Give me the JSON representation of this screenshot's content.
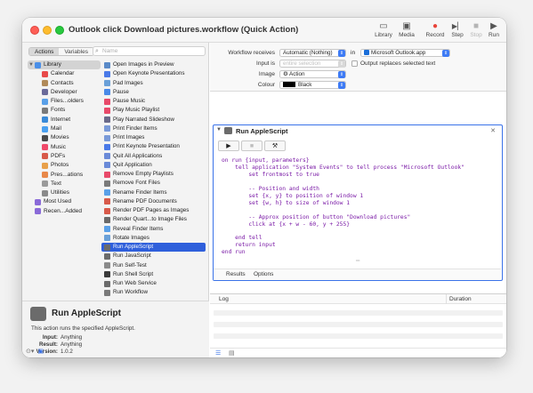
{
  "window": {
    "title": "Outlook click Download pictures.workflow (Quick Action)"
  },
  "toolbar": [
    {
      "label": "Library",
      "icon": "library-icon",
      "glyph": "▭",
      "enabled": true
    },
    {
      "label": "Media",
      "icon": "media-icon",
      "glyph": "▣",
      "enabled": true
    },
    {
      "label": "Record",
      "icon": "record-icon",
      "glyph": "●",
      "enabled": true
    },
    {
      "label": "Step",
      "icon": "step-icon",
      "glyph": "▶▏",
      "enabled": true
    },
    {
      "label": "Stop",
      "icon": "stop-icon",
      "glyph": "■",
      "enabled": false
    },
    {
      "label": "Run",
      "icon": "run-icon",
      "glyph": "▶",
      "enabled": true
    }
  ],
  "tabs": {
    "actions": "Actions",
    "variables": "Variables"
  },
  "search": {
    "placeholder": "Name"
  },
  "library": [
    {
      "label": "Library",
      "color": "#4a8fe8",
      "level": 0,
      "selected": true
    },
    {
      "label": "Calendar",
      "color": "#e84a4a",
      "level": 1
    },
    {
      "label": "Contacts",
      "color": "#b08a5a",
      "level": 1
    },
    {
      "label": "Developer",
      "color": "#6a6a9a",
      "level": 1
    },
    {
      "label": "Files...olders",
      "color": "#5aa0e8",
      "level": 1
    },
    {
      "label": "Fonts",
      "color": "#7a7a7a",
      "level": 1
    },
    {
      "label": "Internet",
      "color": "#3a8ad8",
      "level": 1
    },
    {
      "label": "Mail",
      "color": "#4aa0f0",
      "level": 1
    },
    {
      "label": "Movies",
      "color": "#4a4a4a",
      "level": 1
    },
    {
      "label": "Music",
      "color": "#f04a6a",
      "level": 1
    },
    {
      "label": "PDFs",
      "color": "#d85a4a",
      "level": 1
    },
    {
      "label": "Photos",
      "color": "#e8a04a",
      "level": 1
    },
    {
      "label": "Pres...ations",
      "color": "#e8884a",
      "level": 1
    },
    {
      "label": "Text",
      "color": "#9a9a9a",
      "level": 1
    },
    {
      "label": "Utilities",
      "color": "#8a8a8a",
      "level": 1
    },
    {
      "label": "Most Used",
      "color": "#8a6ad8",
      "level": 0
    },
    {
      "label": "Recen...Added",
      "color": "#8a6ad8",
      "level": 0
    }
  ],
  "actions": [
    {
      "label": "Open Images in Preview",
      "color": "#5a8ac8"
    },
    {
      "label": "Open Keynote Presentations",
      "color": "#4a7ae8"
    },
    {
      "label": "Pad Images",
      "color": "#6aa0d8"
    },
    {
      "label": "Pause",
      "color": "#4a8ae8"
    },
    {
      "label": "Pause Music",
      "color": "#e84a6a"
    },
    {
      "label": "Play Music Playlist",
      "color": "#e84a6a"
    },
    {
      "label": "Play Narrated Slideshow",
      "color": "#6a6a8a"
    },
    {
      "label": "Print Finder Items",
      "color": "#7a9ad8"
    },
    {
      "label": "Print Images",
      "color": "#7a9ad8"
    },
    {
      "label": "Print Keynote Presentation",
      "color": "#4a7ae8"
    },
    {
      "label": "Quit All Applications",
      "color": "#6a8ad8"
    },
    {
      "label": "Quit Application",
      "color": "#6a8ad8"
    },
    {
      "label": "Remove Empty Playlists",
      "color": "#e84a6a"
    },
    {
      "label": "Remove Font Files",
      "color": "#7a7a7a"
    },
    {
      "label": "Rename Finder Items",
      "color": "#5aa0e8"
    },
    {
      "label": "Rename PDF Documents",
      "color": "#d85a4a"
    },
    {
      "label": "Render PDF Pages as Images",
      "color": "#d85a4a"
    },
    {
      "label": "Render Quart...to Image Files",
      "color": "#6a6a6a"
    },
    {
      "label": "Reveal Finder Items",
      "color": "#5aa0e8"
    },
    {
      "label": "Rotate Images",
      "color": "#6aa0d8"
    },
    {
      "label": "Run AppleScript",
      "color": "#6b6b6b",
      "selected": true
    },
    {
      "label": "Run JavaScript",
      "color": "#6b6b6b"
    },
    {
      "label": "Run Self-Test",
      "color": "#8a8a8a"
    },
    {
      "label": "Run Shell Script",
      "color": "#3a3a3a"
    },
    {
      "label": "Run Web Service",
      "color": "#6b6b6b"
    },
    {
      "label": "Run Workflow",
      "color": "#7a7a7a"
    }
  ],
  "info": {
    "title": "Run AppleScript",
    "description": "This action runs the specified AppleScript.",
    "input_key": "Input:",
    "input_val": "Anything",
    "result_key": "Result:",
    "result_val": "Anything",
    "version_key": "Version:",
    "version_val": "1.0.2"
  },
  "workflow": {
    "receives_label": "Workflow receives",
    "receives_value": "Automatic (Nothing)",
    "in_label": "in",
    "app_value": "Microsoft Outlook.app",
    "input_label": "Input is",
    "input_value": "entire selection",
    "replaces_label": "Output replaces selected text",
    "image_label": "Image",
    "image_value": "⚙ Action",
    "colour_label": "Colour",
    "colour_value": "Black"
  },
  "action": {
    "title": "Run AppleScript",
    "code_lines": [
      "on run {input, parameters}",
      "    tell application \"System Events\" to tell process \"Microsoft Outlook\"",
      "        set frontmost to true",
      "",
      "        -- Position and width",
      "        set {x, y} to position of window 1",
      "        set {w, h} to size of window 1",
      "",
      "        -- Approx position of button \"Download pictures\"",
      "        click at {x + w - 60, y + 255}",
      "",
      "    end tell",
      "    return input",
      "end run"
    ],
    "results_tab": "Results",
    "options_tab": "Options"
  },
  "log": {
    "log_header": "Log",
    "duration_header": "Duration"
  },
  "colors": {
    "accent": "#2f5fdb",
    "run_border": "#3a72e8"
  }
}
